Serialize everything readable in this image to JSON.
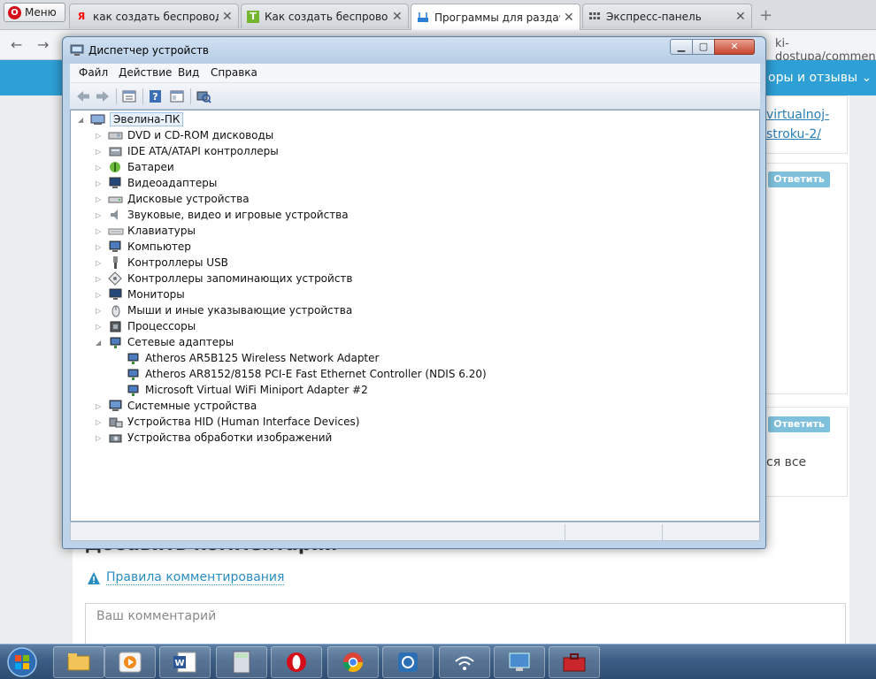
{
  "browser": {
    "menu_label": "Меню",
    "tabs": [
      {
        "title": "как создать беспроводно",
        "icon": "yandex-icon",
        "color": "#ff0000"
      },
      {
        "title": "Как создать беспроводно",
        "icon": "tproger-icon",
        "color": "#74b72e"
      },
      {
        "title": "Программы для раздачи",
        "icon": "router-icon",
        "color": "#2a7fd4"
      },
      {
        "title": "Экспресс-панель",
        "icon": "grid-icon",
        "color": "#555555"
      }
    ],
    "close_glyph": "✕",
    "new_tab_glyph": "+",
    "back_glyph": "←",
    "forward_glyph": "→",
    "url_tail": "ki-dostupa/comment-"
  },
  "page": {
    "reviews_link": "оры и отзывы ⌄",
    "link_frag_1": "virtualnoj-",
    "link_frag_2": "stroku-2/",
    "reply_label": "Ответить",
    "all_frag": "ся все",
    "add_comment_heading": "Добавить комментарий",
    "rules_link": "Правила комментирования",
    "comment_placeholder": "Ваш комментарий",
    "accent_color": "#2ea0d5"
  },
  "window": {
    "title": "Диспетчер устройств",
    "minimize_glyph": "▁",
    "maximize_glyph": "▢",
    "close_glyph": "✕",
    "menu": [
      "Файл",
      "Действие",
      "Вид",
      "Справка"
    ],
    "toolbar": [
      "back-icon",
      "forward-icon",
      "properties-icon",
      "help-icon",
      "view-icon",
      "scan-hardware-icon"
    ]
  },
  "tree": {
    "root": "Эвелина-ПК",
    "categories": [
      {
        "label": "DVD и CD-ROM дисководы",
        "icon": "dvd-icon"
      },
      {
        "label": "IDE ATA/ATAPI контроллеры",
        "icon": "ide-controller-icon"
      },
      {
        "label": "Батареи",
        "icon": "battery-icon"
      },
      {
        "label": "Видеоадаптеры",
        "icon": "display-adapter-icon"
      },
      {
        "label": "Дисковые устройства",
        "icon": "disk-icon"
      },
      {
        "label": "Звуковые, видео и игровые устройства",
        "icon": "sound-icon"
      },
      {
        "label": "Клавиатуры",
        "icon": "keyboard-icon"
      },
      {
        "label": "Компьютер",
        "icon": "computer-icon"
      },
      {
        "label": "Контроллеры USB",
        "icon": "usb-icon"
      },
      {
        "label": "Контроллеры запоминающих устройств",
        "icon": "storage-controller-icon"
      },
      {
        "label": "Мониторы",
        "icon": "monitor-icon"
      },
      {
        "label": "Мыши и иные указывающие устройства",
        "icon": "mouse-icon"
      },
      {
        "label": "Процессоры",
        "icon": "processor-icon"
      },
      {
        "label": "Сетевые адаптеры",
        "icon": "network-adapter-icon",
        "expanded": true,
        "children": [
          "Atheros AR5B125 Wireless Network Adapter",
          "Atheros AR8152/8158 PCI-E Fast Ethernet Controller (NDIS 6.20)",
          "Microsoft Virtual WiFi Miniport Adapter #2"
        ]
      },
      {
        "label": "Системные устройства",
        "icon": "system-devices-icon"
      },
      {
        "label": "Устройства HID (Human Interface Devices)",
        "icon": "hid-icon"
      },
      {
        "label": "Устройства обработки изображений",
        "icon": "imaging-icon"
      }
    ]
  },
  "taskbar": {
    "apps": [
      "explorer-icon",
      "media-player-icon",
      "word-icon",
      "calculator-icon",
      "opera-icon",
      "chrome-icon",
      "connectify-icon",
      "wifi-icon",
      "network-monitor-icon",
      "toolbox-icon"
    ]
  }
}
